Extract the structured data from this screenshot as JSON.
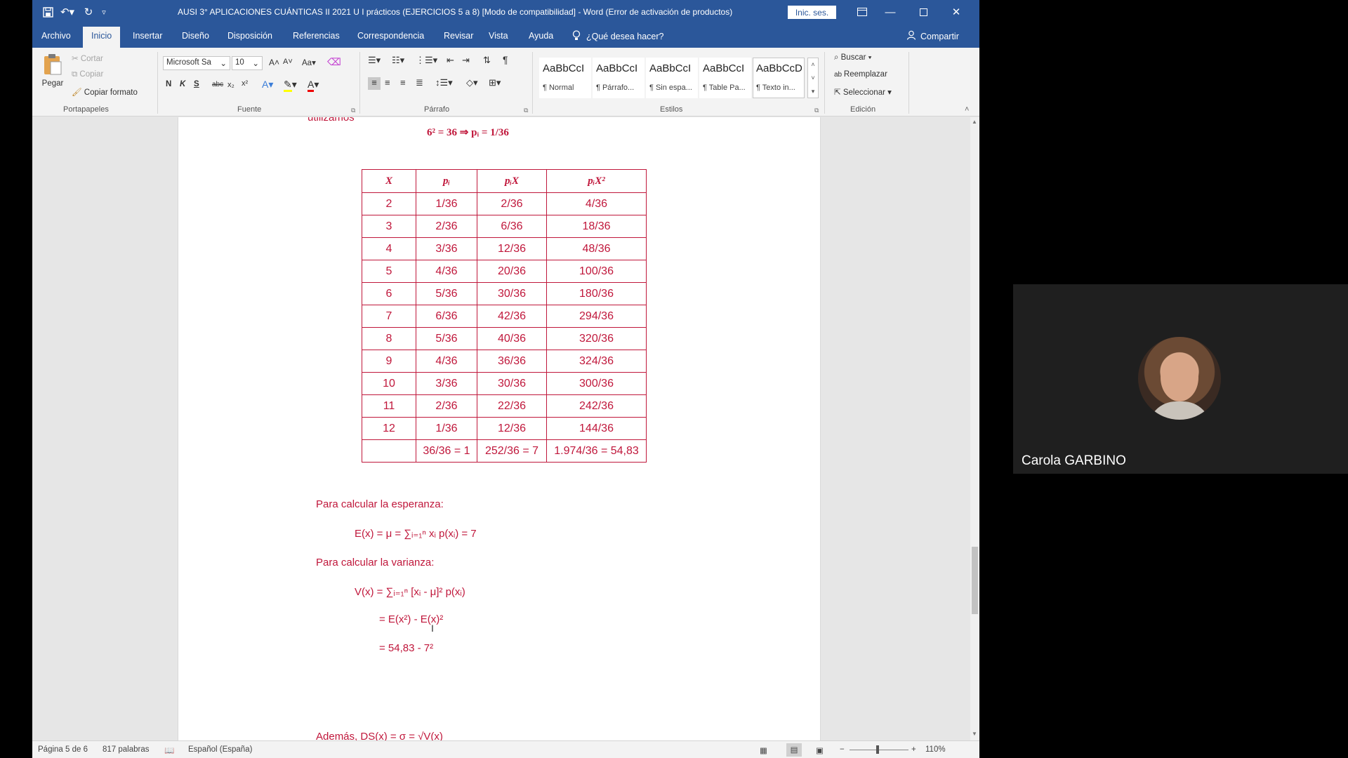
{
  "titlebar": {
    "title": "AUSI 3° APLICACIONES CUÁNTICAS II 2021 U I prácticos (EJERCICIOS 5 a 8) [Modo de compatibilidad] - Word (Error de activación de productos)",
    "signin": "Inic. ses.",
    "icons": [
      "save-icon",
      "undo-icon",
      "redo-icon",
      "customize-icon"
    ]
  },
  "tabs": [
    "Archivo",
    "Inicio",
    "Insertar",
    "Diseño",
    "Disposición",
    "Referencias",
    "Correspondencia",
    "Revisar",
    "Vista",
    "Ayuda"
  ],
  "tell_me": "¿Qué desea hacer?",
  "share": "Compartir",
  "ribbon": {
    "clipboard": {
      "paste": "Pegar",
      "cut": "Cortar",
      "copy": "Copiar",
      "format_painter": "Copiar formato",
      "label": "Portapapeles"
    },
    "font": {
      "name": "Microsoft Sa",
      "size": "10",
      "bold": "N",
      "italic": "K",
      "underline": "S",
      "label": "Fuente"
    },
    "paragraph": {
      "label": "Párrafo"
    },
    "styles": {
      "label": "Estilos",
      "items": [
        {
          "preview": "AaBbCcI",
          "name": "¶ Normal"
        },
        {
          "preview": "AaBbCcI",
          "name": "¶ Párrafo..."
        },
        {
          "preview": "AaBbCcI",
          "name": "¶ Sin espa..."
        },
        {
          "preview": "AaBbCcI",
          "name": "¶ Table Pa..."
        },
        {
          "preview": "AaBbCcD",
          "name": "¶ Texto in..."
        }
      ]
    },
    "editing": {
      "find": "Buscar",
      "replace": "Reemplazar",
      "select": "Seleccionar",
      "label": "Edición"
    }
  },
  "document": {
    "top_fragment": "utilizamos",
    "formula_top": "6² = 36  ⇒  pᵢ = 1/36",
    "table": {
      "headers": [
        "X",
        "pᵢ",
        "pᵢX",
        "pᵢX²"
      ],
      "rows": [
        [
          "2",
          "1/36",
          "2/36",
          "4/36"
        ],
        [
          "3",
          "2/36",
          "6/36",
          "18/36"
        ],
        [
          "4",
          "3/36",
          "12/36",
          "48/36"
        ],
        [
          "5",
          "4/36",
          "20/36",
          "100/36"
        ],
        [
          "6",
          "5/36",
          "30/36",
          "180/36"
        ],
        [
          "7",
          "6/36",
          "42/36",
          "294/36"
        ],
        [
          "8",
          "5/36",
          "40/36",
          "320/36"
        ],
        [
          "9",
          "4/36",
          "36/36",
          "324/36"
        ],
        [
          "10",
          "3/36",
          "30/36",
          "300/36"
        ],
        [
          "11",
          "2/36",
          "22/36",
          "242/36"
        ],
        [
          "12",
          "1/36",
          "12/36",
          "144/36"
        ]
      ],
      "totals": [
        "",
        "36/36 = 1",
        "252/36 = 7",
        "1.974/36 = 54,83"
      ]
    },
    "esperanza_heading": "Para calcular la esperanza:",
    "esperanza_formula": "E(x) = μ = ∑ᵢ₌₁ⁿ xᵢ p(xᵢ) = 7",
    "varianza_heading": "Para calcular la varianza:",
    "varianza_line1": "V(x) = ∑ᵢ₌₁ⁿ [xᵢ - μ]² p(xᵢ)",
    "varianza_line2": "= E(x²) - E(x)²",
    "varianza_line3": "= 54,83 - 7²",
    "bottom_line": "Además, DS(x) = σ = √V(x)"
  },
  "status": {
    "page": "Página 5 de 6",
    "words": "817 palabras",
    "language": "Español (España)",
    "zoom": "110%"
  },
  "participant": {
    "name": "Carola GARBINO"
  },
  "colors": {
    "word_blue": "#2b579a",
    "doc_red": "#c0173b"
  }
}
